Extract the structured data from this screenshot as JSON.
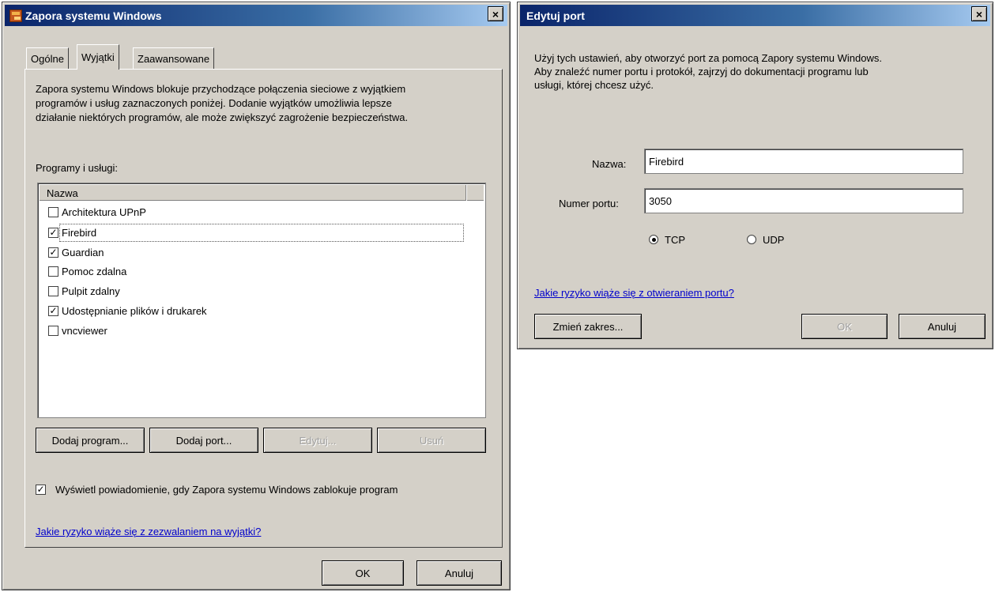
{
  "firewall": {
    "title": "Zapora systemu Windows",
    "close_glyph": "×",
    "tabs": [
      {
        "label": "Ogólne"
      },
      {
        "label": "Wyjątki"
      },
      {
        "label": "Zaawansowane"
      }
    ],
    "description_lines": [
      "Zapora systemu Windows blokuje przychodzące połączenia sieciowe z wyjątkiem",
      "programów i usług zaznaczonych poniżej. Dodanie wyjątków umożliwia lepsze",
      "działanie niektórych programów, ale może zwiększyć zagrożenie bezpieczeństwa."
    ],
    "list_label": "Programy i usługi:",
    "column_name": "Nazwa",
    "items": [
      {
        "label": "Architektura UPnP",
        "checked": false,
        "mark": ""
      },
      {
        "label": "Firebird",
        "checked": true,
        "mark": "✓"
      },
      {
        "label": "Guardian",
        "checked": true,
        "mark": "✓"
      },
      {
        "label": "Pomoc zdalna",
        "checked": false,
        "mark": ""
      },
      {
        "label": "Pulpit zdalny",
        "checked": false,
        "mark": ""
      },
      {
        "label": "Udostępnianie plików i drukarek",
        "checked": true,
        "mark": "✓"
      },
      {
        "label": "vncviewer",
        "checked": false,
        "mark": ""
      }
    ],
    "buttons": {
      "add_program": "Dodaj program...",
      "add_port": "Dodaj port...",
      "edit": "Edytuj...",
      "delete": "Usuń"
    },
    "notify_checkbox": {
      "label": "Wyświetl powiadomienie, gdy Zapora systemu Windows zablokuje program",
      "checked": true,
      "mark": "✓"
    },
    "risk_link": "Jakie ryzyko wiąże się z zezwalaniem na wyjątki?",
    "ok": "OK",
    "cancel": "Anuluj"
  },
  "edit_port": {
    "title": "Edytuj port",
    "close_glyph": "×",
    "description_lines": [
      "Użyj tych ustawień, aby otworzyć port za pomocą Zapory systemu Windows.",
      "Aby znaleźć numer portu i protokół, zajrzyj do dokumentacji programu lub",
      "usługi, której chcesz użyć."
    ],
    "name_label": "Nazwa:",
    "name_value": "Firebird",
    "port_label": "Numer portu:",
    "port_value": "3050",
    "protocols": [
      {
        "label": "TCP",
        "selected": true
      },
      {
        "label": "UDP",
        "selected": false
      }
    ],
    "risk_link": "Jakie ryzyko wiąże się z otwieraniem portu?",
    "change_scope": "Zmień zakres...",
    "ok": "OK",
    "cancel": "Anuluj"
  },
  "colors": {
    "title_start": "#0a246a",
    "title_end": "#a6caf0",
    "face": "#d4d0c8",
    "link": "#0000cc"
  }
}
